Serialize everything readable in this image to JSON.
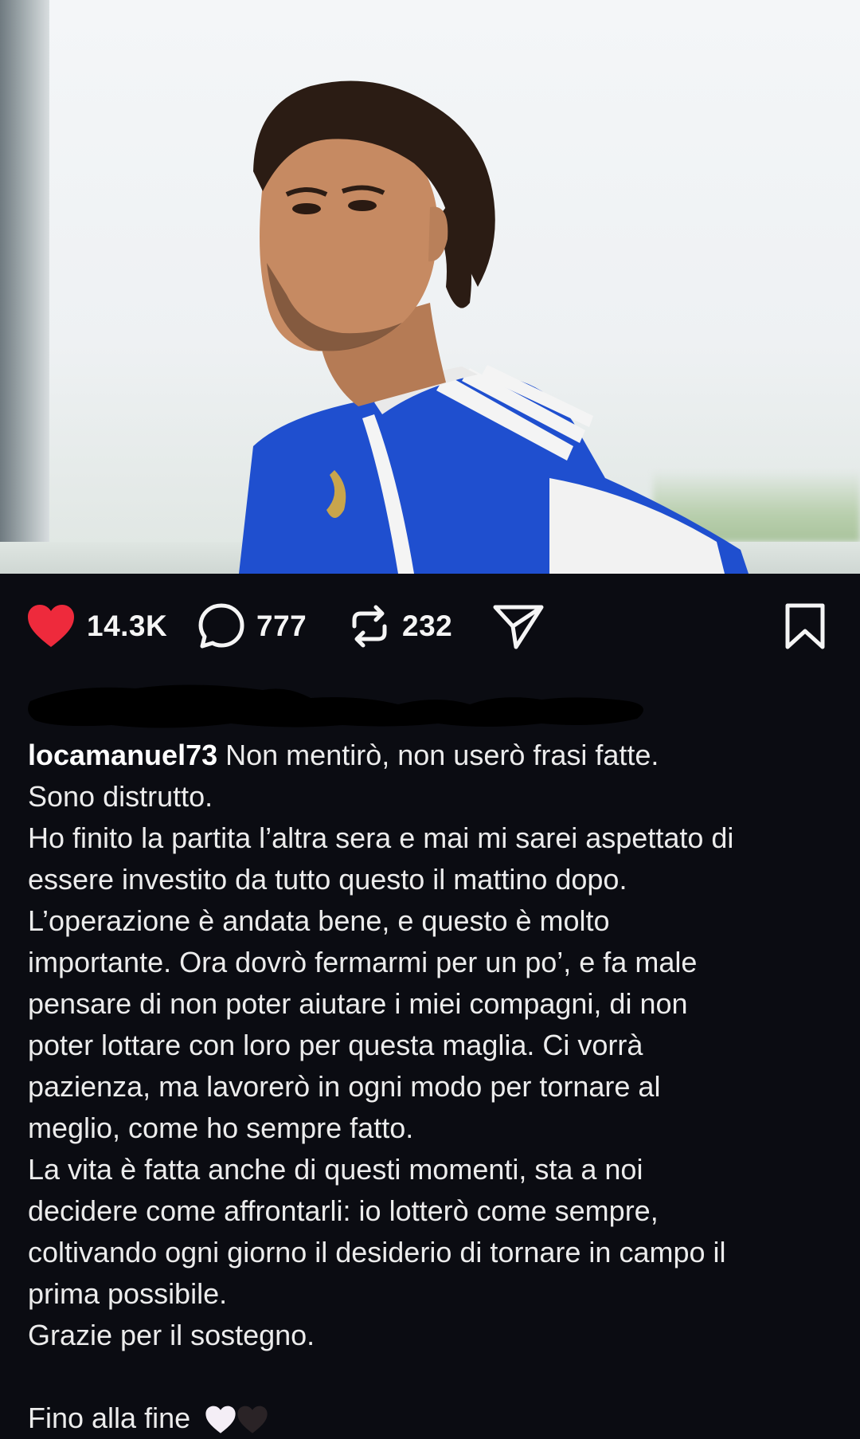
{
  "post": {
    "username": "locamanuel73",
    "caption_first": "Non mentirò, non userò frasi fatte.",
    "caption_lines": [
      "Sono distrutto.",
      "Ho finito la partita l’altra sera e mai mi sarei aspettato di",
      "essere investito da tutto questo il mattino dopo.",
      "L’operazione è andata bene, e questo è molto",
      "importante. Ora dovrò fermarmi per un po’, e fa male",
      "pensare di non poter aiutare i miei compagni, di non",
      "poter lottare con loro per questa maglia. Ci vorrà",
      "pazienza, ma lavorerò in ogni modo per tornare al",
      "meglio, come ho sempre fatto.",
      "La vita è fatta anche di questi momenti, sta a noi",
      "decidere come affrontarli: io lotterò come sempre,",
      "coltivando ogni giorno il desiderio di tornare in campo il",
      "prima possibile.",
      "Grazie per il sostegno."
    ],
    "caption_closing": "Fino alla fine"
  },
  "actions": {
    "likes": "14.3K",
    "comments": "777",
    "reposts": "232"
  },
  "icons": {
    "like": "heart-icon",
    "comment": "comment-bubble-icon",
    "repost": "repost-icon",
    "share": "share-send-icon",
    "save": "bookmark-icon"
  },
  "colors": {
    "background": "#0b0c12",
    "like_red": "#ee2a3c",
    "text": "#f2f2f2"
  }
}
